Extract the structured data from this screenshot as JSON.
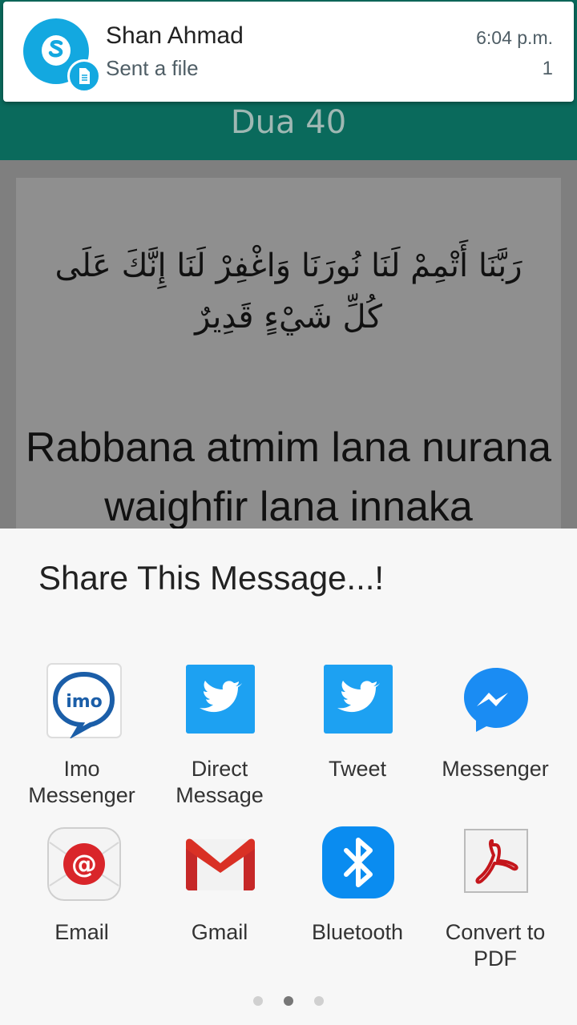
{
  "notification": {
    "sender": "Shan Ahmad",
    "message": "Sent a file",
    "time": "6:04 p.m.",
    "count": "1",
    "app_icon": "skype-icon"
  },
  "app": {
    "title": "Dua 40",
    "arabic_text": "رَبَّنَا أَتْمِمْ لَنَا نُورَنَا وَاغْفِرْ لَنَا إِنَّكَ عَلَى كُلِّ شَيْءٍ قَدِيرٌ",
    "transliteration": "Rabbana atmim lana nurana waighfir lana innaka"
  },
  "share_sheet": {
    "title": "Share This Message...!",
    "targets": [
      {
        "label": "Imo Messenger",
        "icon": "imo-icon"
      },
      {
        "label": "Direct Message",
        "icon": "twitter-icon"
      },
      {
        "label": "Tweet",
        "icon": "twitter-icon"
      },
      {
        "label": "Messenger",
        "icon": "messenger-icon"
      },
      {
        "label": "Email",
        "icon": "email-icon"
      },
      {
        "label": "Gmail",
        "icon": "gmail-icon"
      },
      {
        "label": "Bluetooth",
        "icon": "bluetooth-icon"
      },
      {
        "label": "Convert to PDF",
        "icon": "pdf-icon"
      }
    ],
    "page_count": 3,
    "current_page": 2
  },
  "colors": {
    "app_bar": "#0a6a5c",
    "skype": "#13a8e0",
    "twitter": "#1da1f2",
    "messenger": "#1a8cf3",
    "bluetooth": "#0a8cf0"
  }
}
